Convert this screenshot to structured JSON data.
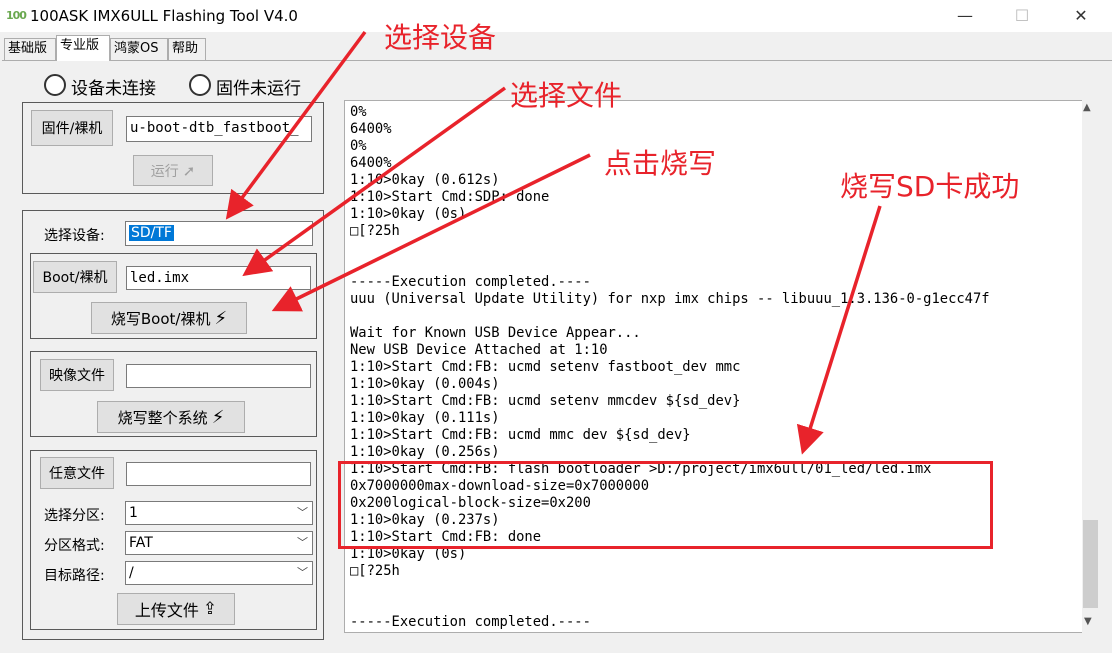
{
  "window": {
    "logo": "100",
    "title": "100ASK IMX6ULL Flashing Tool V4.0",
    "minimize": "—",
    "maximize": "☐",
    "close": "✕"
  },
  "tabs": [
    {
      "label": "基础版"
    },
    {
      "label": "专业版"
    },
    {
      "label": "鸿蒙OS"
    },
    {
      "label": "帮助"
    }
  ],
  "status": {
    "device": "设备未连接",
    "firmware": "固件未运行"
  },
  "firmware_group": {
    "button": "固件/裸机",
    "file": "u-boot-dtb_fastboot_",
    "run_button": "运行"
  },
  "device_group": {
    "select_label": "选择设备:",
    "select_value": "SD/TF",
    "boot_button": "Boot/裸机",
    "boot_file": "led.imx",
    "flash_boot_button": "烧写Boot/裸机"
  },
  "image_group": {
    "button": "映像文件",
    "file": "",
    "flash_system_button": "烧写整个系统"
  },
  "any_group": {
    "button": "任意文件",
    "file": "",
    "partition_label": "选择分区:",
    "partition_value": "1",
    "format_label": "分区格式:",
    "format_value": "FAT",
    "path_label": "目标路径:",
    "path_value": "/",
    "upload_button": "上传文件"
  },
  "log_lines": [
    "0%",
    "6400%",
    "0%",
    "6400%",
    "1:10>0kay (0.612s)",
    "1:10>Start Cmd:SDP: done",
    "1:10>0kay (0s)",
    "□[?25h",
    "",
    "",
    "-----Execution completed.----",
    "uuu (Universal Update Utility) for nxp imx chips -- libuuu_1.3.136-0-g1ecc47f",
    "",
    "Wait for Known USB Device Appear...",
    "New USB Device Attached at 1:10",
    "1:10>Start Cmd:FB: ucmd setenv fastboot_dev mmc",
    "1:10>0kay (0.004s)",
    "1:10>Start Cmd:FB: ucmd setenv mmcdev ${sd_dev}",
    "1:10>0kay (0.111s)",
    "1:10>Start Cmd:FB: ucmd mmc dev ${sd_dev}",
    "1:10>0kay (0.256s)",
    "1:10>Start Cmd:FB: flash bootloader >D:/project/imx6ull/01_led/led.imx",
    "0x7000000max-download-size=0x7000000",
    "0x200logical-block-size=0x200",
    "1:10>0kay (0.237s)",
    "1:10>Start Cmd:FB: done",
    "1:10>0kay (0s)",
    "□[?25h",
    "",
    "",
    "-----Execution completed.----"
  ],
  "annotations": {
    "select_device": "选择设备",
    "select_file": "选择文件",
    "click_flash": "点击烧写",
    "flash_success": "烧写SD卡成功"
  },
  "colors": {
    "annotation": "#e8232b",
    "selection": "#0078d7"
  }
}
